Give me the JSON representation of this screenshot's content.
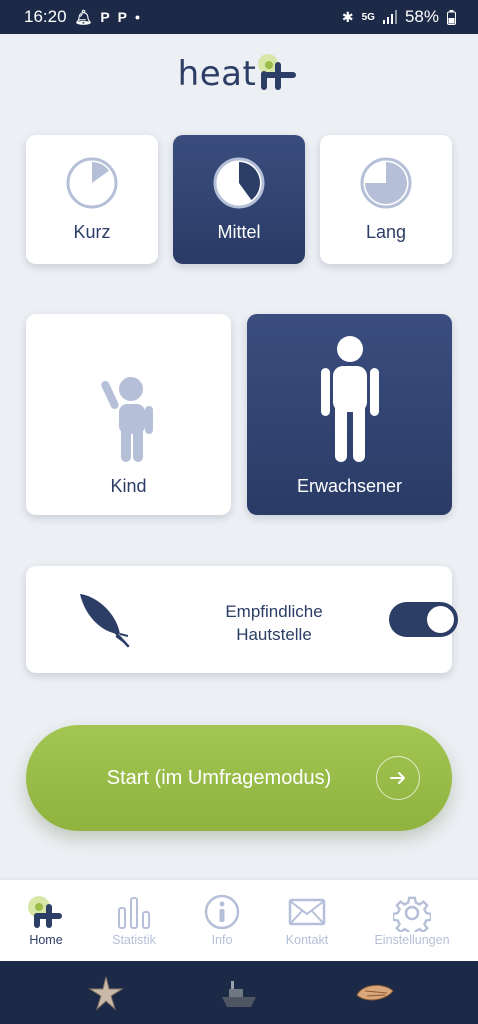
{
  "status_bar": {
    "time": "16:20",
    "network": "5G",
    "battery": "58%"
  },
  "logo": {
    "text": "heat"
  },
  "duration": {
    "options": [
      {
        "label": "Kurz",
        "fill": 0.15
      },
      {
        "label": "Mittel",
        "fill": 0.4
      },
      {
        "label": "Lang",
        "fill": 0.75
      }
    ],
    "selected": "Mittel"
  },
  "age": {
    "options": [
      {
        "label": "Kind"
      },
      {
        "label": "Erwachsener"
      }
    ],
    "selected": "Erwachsener"
  },
  "sensitive": {
    "label": "Empfindliche Hautstelle",
    "enabled": true
  },
  "start_button": {
    "label": "Start (im Umfragemodus)"
  },
  "bottom_nav": {
    "items": [
      {
        "label": "Home",
        "icon": "heat-logo-icon"
      },
      {
        "label": "Statistik",
        "icon": "bar-chart-icon"
      },
      {
        "label": "Info",
        "icon": "info-icon"
      },
      {
        "label": "Kontakt",
        "icon": "mail-icon"
      },
      {
        "label": "Einstellungen",
        "icon": "gear-icon"
      }
    ],
    "active": "Home"
  },
  "colors": {
    "primary": "#2c3d66",
    "accent_green": "#9bbd4a",
    "inactive_icon": "#b5c0d8",
    "background": "#eceff3"
  }
}
